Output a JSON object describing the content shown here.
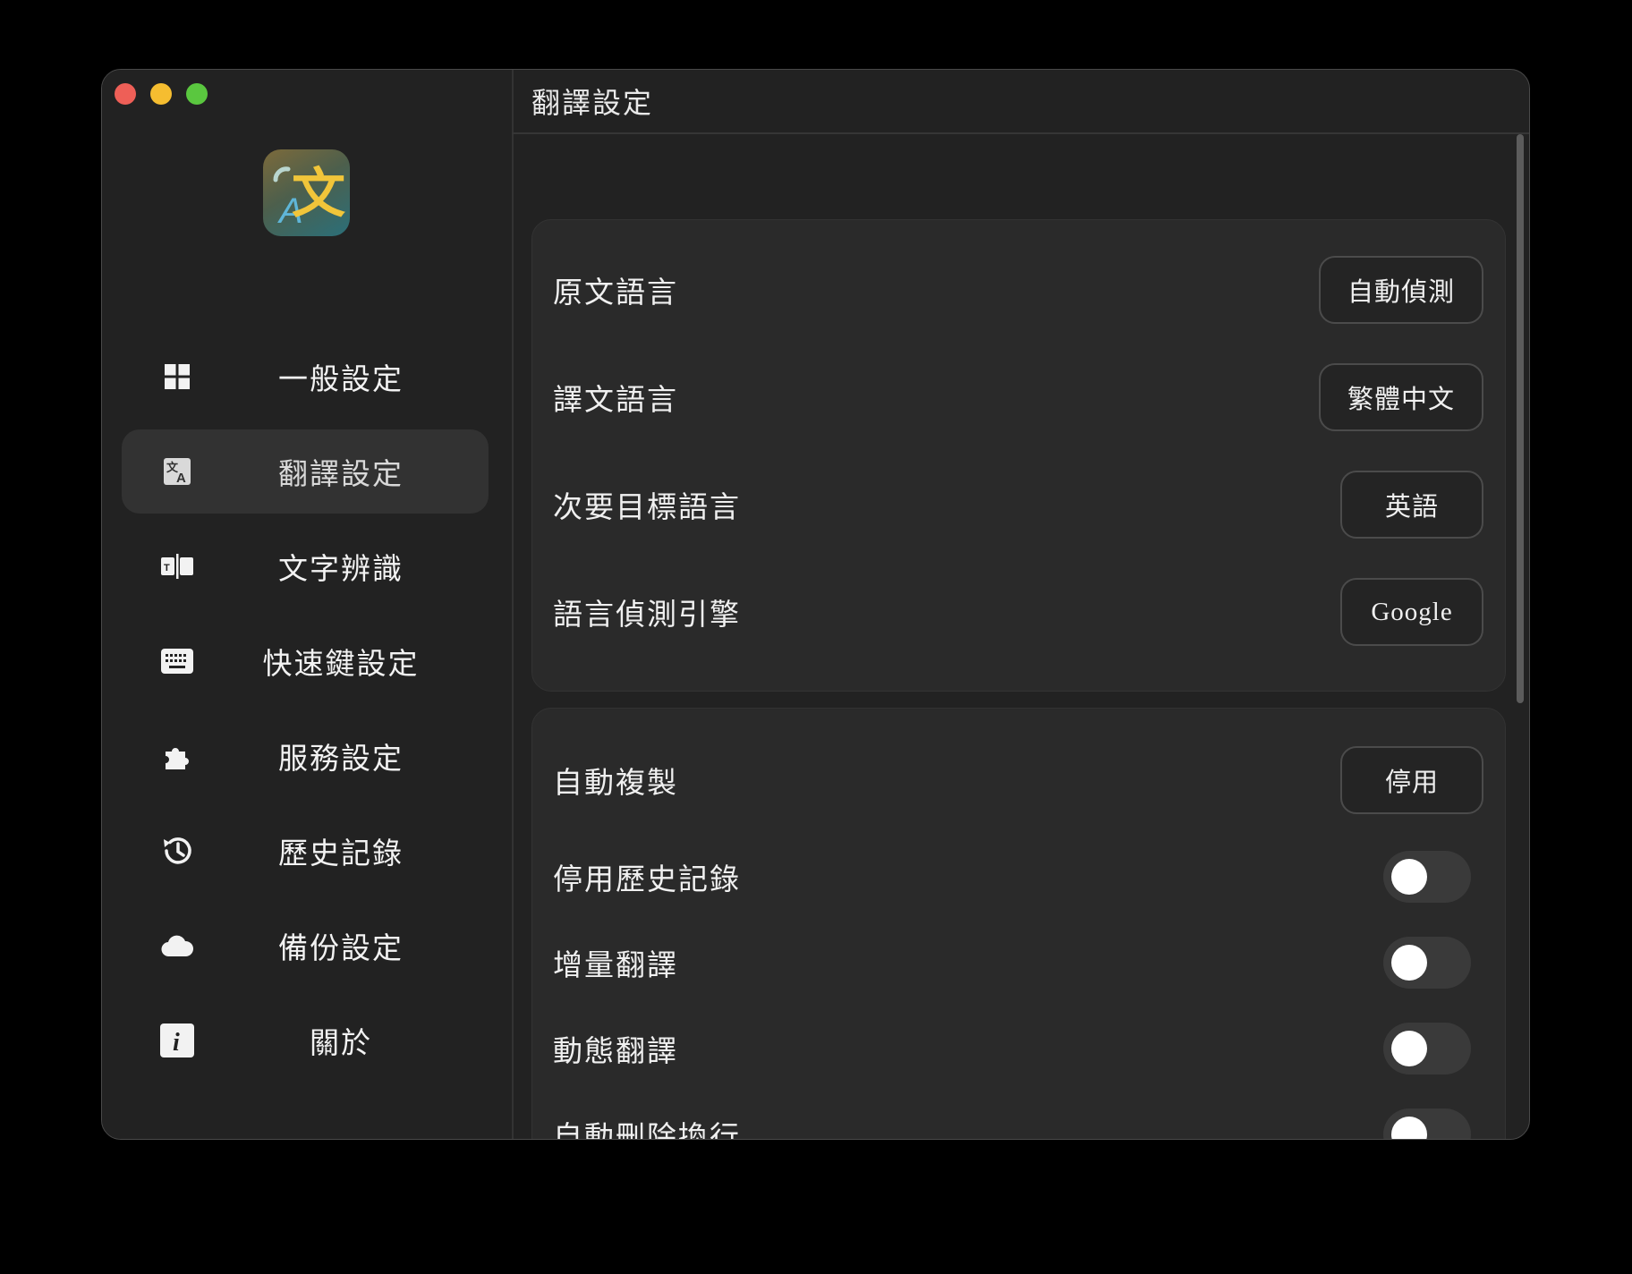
{
  "window": {
    "title": "翻譯設定"
  },
  "sidebar": {
    "items": [
      {
        "label": "一般設定",
        "icon": "grid-icon"
      },
      {
        "label": "翻譯設定",
        "icon": "translate-icon",
        "active": true
      },
      {
        "label": "文字辨識",
        "icon": "ocr-icon"
      },
      {
        "label": "快速鍵設定",
        "icon": "keyboard-icon"
      },
      {
        "label": "服務設定",
        "icon": "puzzle-icon"
      },
      {
        "label": "歷史記錄",
        "icon": "history-icon"
      },
      {
        "label": "備份設定",
        "icon": "cloud-icon"
      },
      {
        "label": "關於",
        "icon": "info-icon"
      }
    ]
  },
  "language_card": {
    "rows": [
      {
        "label": "原文語言",
        "value": "自動偵測"
      },
      {
        "label": "譯文語言",
        "value": "繁體中文"
      },
      {
        "label": "次要目標語言",
        "value": "英語"
      },
      {
        "label": "語言偵測引擎",
        "value": "Google"
      }
    ]
  },
  "options_card": {
    "auto_copy": {
      "label": "自動複製",
      "value": "停用"
    },
    "toggles": [
      {
        "label": "停用歷史記錄",
        "on": false
      },
      {
        "label": "增量翻譯",
        "on": false
      },
      {
        "label": "動態翻譯",
        "on": false
      },
      {
        "label": "自動刪除換行",
        "on": false
      }
    ]
  },
  "colors": {
    "background": "#000000",
    "window": "#222222",
    "card": "#2a2a2a",
    "active_item": "#323232",
    "traffic_red": "#ee5f57",
    "traffic_yellow": "#f5bd30",
    "traffic_green": "#5ac73f"
  }
}
